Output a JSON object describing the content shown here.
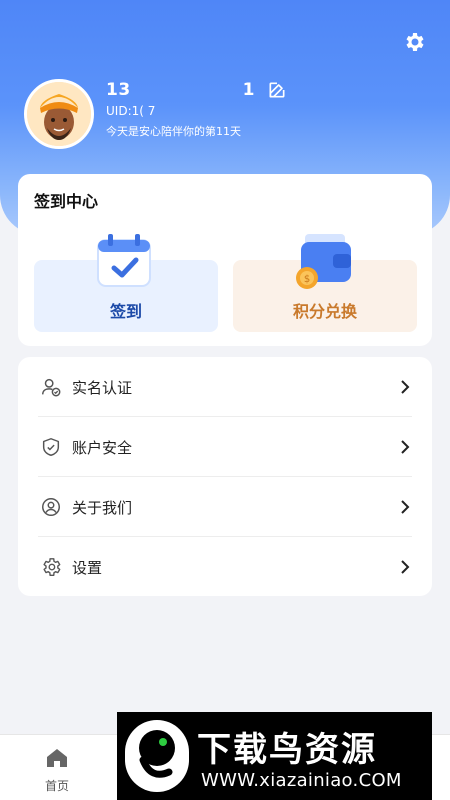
{
  "profile": {
    "phone_prefix": "13",
    "phone_suffix": "1",
    "uid": "UID:1(       7",
    "days_text": "今天是安心陪伴你的第11天"
  },
  "signin_center": {
    "title": "签到中心",
    "signin_label": "签到",
    "exchange_label": "积分兑换"
  },
  "menu": {
    "items": [
      {
        "label": "实名认证",
        "icon": "user-verify-icon"
      },
      {
        "label": "账户安全",
        "icon": "shield-check-icon"
      },
      {
        "label": "关于我们",
        "icon": "user-circle-icon"
      },
      {
        "label": "设置",
        "icon": "gear-icon"
      }
    ]
  },
  "tabbar": {
    "home_label": "首页"
  },
  "watermark": {
    "title": "下载鸟资源",
    "url": "WWW.xiazainiao.COM"
  },
  "colors": {
    "header_blue": "#4f86f7",
    "signin_blue": "#1c4aa8",
    "exchange_orange": "#c97a2c"
  }
}
